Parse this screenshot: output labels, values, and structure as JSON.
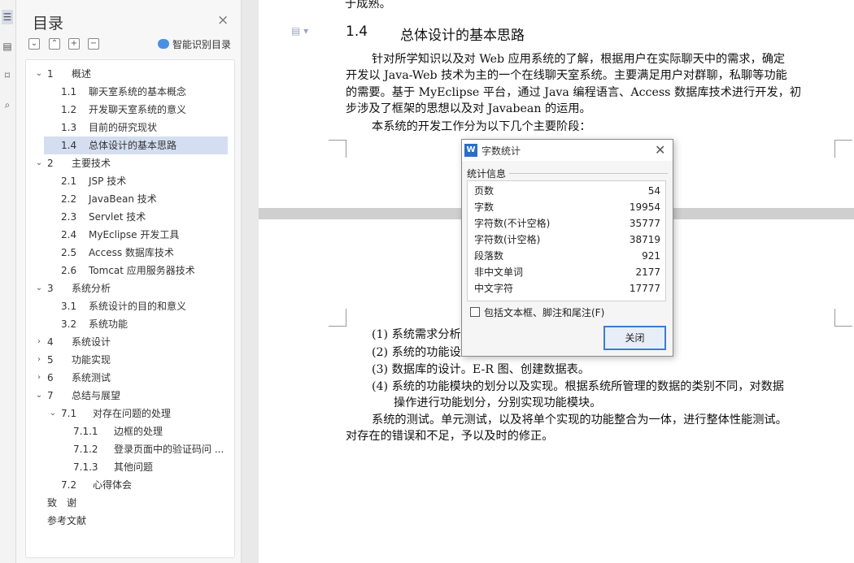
{
  "rail": {
    "icons": [
      "list-icon",
      "page-icon",
      "bookmark-icon",
      "search-icon"
    ]
  },
  "toc": {
    "title": "目录",
    "smart_label": "智能识别目录",
    "items": [
      {
        "num": "1",
        "label": "概述",
        "arrow": "⌄"
      },
      {
        "num": "1.1",
        "label": "聊天室系统的基本概念"
      },
      {
        "num": "1.2",
        "label": "开发聊天室系统的意义"
      },
      {
        "num": "1.3",
        "label": "目前的研究现状"
      },
      {
        "num": "1.4",
        "label": "总体设计的基本思路"
      },
      {
        "num": "2",
        "label": "主要技术",
        "arrow": "⌄"
      },
      {
        "num": "2.1",
        "label": "JSP 技术"
      },
      {
        "num": "2.2",
        "label": "JavaBean 技术"
      },
      {
        "num": "2.3",
        "label": "Servlet 技术"
      },
      {
        "num": "2.4",
        "label": "MyEclipse 开发工具"
      },
      {
        "num": "2.5",
        "label": "Access 数据库技术"
      },
      {
        "num": "2.6",
        "label": "Tomcat 应用服务器技术"
      },
      {
        "num": "3",
        "label": "系统分析",
        "arrow": "⌄"
      },
      {
        "num": "3.1",
        "label": "系统设计的目的和意义"
      },
      {
        "num": "3.2",
        "label": "系统功能"
      },
      {
        "num": "4",
        "label": "系统设计",
        "arrow": "›"
      },
      {
        "num": "5",
        "label": "功能实现",
        "arrow": "›"
      },
      {
        "num": "6",
        "label": "系统测试",
        "arrow": "›"
      },
      {
        "num": "7",
        "label": "总结与展望",
        "arrow": "⌄"
      },
      {
        "num": "7.1",
        "label": "对存在问题的处理",
        "arrow": "⌄"
      },
      {
        "num": "7.1.1",
        "label": "边框的处理"
      },
      {
        "num": "7.1.2",
        "label": "登录页面中的验证码问 ..."
      },
      {
        "num": "7.1.3",
        "label": "其他问题"
      },
      {
        "num": "7.2",
        "label": "心得体会"
      },
      {
        "num": "",
        "label": "致　谢"
      },
      {
        "num": "",
        "label": "参考文献"
      }
    ]
  },
  "doc": {
    "top_fragment": "于成熟。",
    "heading_num": "1.4",
    "heading_text": "总体设计的基本思路",
    "p1_l1": "针对所学知识以及对 Web 应用系统的了解，根据用户在实际聊天中的需求，确定",
    "p1_l2": "开发以 Java-Web 技术为主的一个在线聊天室系统。主要满足用户对群聊，私聊等功能",
    "p1_l3": "的需要。基于 MyEclipse 平台，通过 Java 编程语言、Access 数据库技术进行开发，初",
    "p1_l4": "步涉及了框架的思想以及对 Javabean 的运用。",
    "p2": "本系统的开发工作分为以下几个主要阶段：",
    "li1": "(1) 系统需求分析",
    "li2": "(2) 系统的功能设",
    "li3": "(3) 数据库的设计。E-R 图、创建数据表。",
    "li4_l1": "(4) 系统的功能模块的划分以及实现。根据系统所管理的数据的类别不同，对数据",
    "li4_l2": "操作进行功能划分，分别实现功能模块。",
    "p3_l1": "系统的测试。单元测试，以及将单个实现的功能整合为一体，进行整体性能测试。",
    "p3_l2": "对存在的错误和不足，予以及时的修正。"
  },
  "dialog": {
    "title": "字数统计",
    "group": "统计信息",
    "stats": [
      {
        "k": "页数",
        "v": "54"
      },
      {
        "k": "字数",
        "v": "19954"
      },
      {
        "k": "字符数(不计空格)",
        "v": "35777"
      },
      {
        "k": "字符数(计空格)",
        "v": "38719"
      },
      {
        "k": "段落数",
        "v": "921"
      },
      {
        "k": "非中文单词",
        "v": "2177"
      },
      {
        "k": "中文字符",
        "v": "17777"
      }
    ],
    "checkbox_label": "包括文本框、脚注和尾注(F)",
    "close_label": "关闭"
  }
}
